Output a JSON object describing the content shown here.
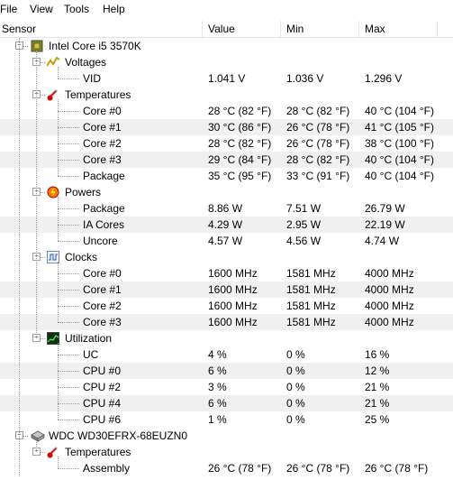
{
  "menu": [
    "File",
    "View",
    "Tools",
    "Help"
  ],
  "columns": {
    "sensor": "Sensor",
    "value": "Value",
    "min": "Min",
    "max": "Max"
  },
  "rows": [
    {
      "type": "device",
      "icon": "cpu-icon",
      "label": "Intel Core i5 3570K"
    },
    {
      "type": "group",
      "icon": "voltage-icon",
      "label": "Voltages"
    },
    {
      "type": "sensor",
      "label": "VID",
      "value": "1.041 V",
      "min": "1.036 V",
      "max": "1.296 V"
    },
    {
      "type": "group",
      "icon": "thermometer-icon",
      "label": "Temperatures"
    },
    {
      "type": "sensor",
      "label": "Core #0",
      "value": "28 °C  (82 °F)",
      "min": "28 °C  (82 °F)",
      "max": "40 °C  (104 °F)"
    },
    {
      "type": "sensor",
      "label": "Core #1",
      "value": "30 °C  (86 °F)",
      "min": "26 °C  (78 °F)",
      "max": "41 °C  (105 °F)"
    },
    {
      "type": "sensor",
      "label": "Core #2",
      "value": "28 °C  (82 °F)",
      "min": "26 °C  (78 °F)",
      "max": "38 °C  (100 °F)"
    },
    {
      "type": "sensor",
      "label": "Core #3",
      "value": "29 °C  (84 °F)",
      "min": "28 °C  (82 °F)",
      "max": "40 °C  (104 °F)"
    },
    {
      "type": "sensor",
      "label": "Package",
      "value": "35 °C  (95 °F)",
      "min": "33 °C  (91 °F)",
      "max": "40 °C  (104 °F)"
    },
    {
      "type": "group",
      "icon": "power-icon",
      "label": "Powers"
    },
    {
      "type": "sensor",
      "label": "Package",
      "value": "8.86 W",
      "min": "7.51 W",
      "max": "26.79 W"
    },
    {
      "type": "sensor",
      "label": "IA Cores",
      "value": "4.29 W",
      "min": "2.95 W",
      "max": "22.19 W"
    },
    {
      "type": "sensor",
      "label": "Uncore",
      "value": "4.57 W",
      "min": "4.56 W",
      "max": "4.74 W"
    },
    {
      "type": "group",
      "icon": "clock-icon",
      "label": "Clocks"
    },
    {
      "type": "sensor",
      "label": "Core #0",
      "value": "1600 MHz",
      "min": "1581 MHz",
      "max": "4000 MHz"
    },
    {
      "type": "sensor",
      "label": "Core #1",
      "value": "1600 MHz",
      "min": "1581 MHz",
      "max": "4000 MHz"
    },
    {
      "type": "sensor",
      "label": "Core #2",
      "value": "1600 MHz",
      "min": "1581 MHz",
      "max": "4000 MHz"
    },
    {
      "type": "sensor",
      "label": "Core #3",
      "value": "1600 MHz",
      "min": "1581 MHz",
      "max": "4000 MHz"
    },
    {
      "type": "group",
      "icon": "utilization-icon",
      "label": "Utilization"
    },
    {
      "type": "sensor",
      "label": "UC",
      "value": "4 %",
      "min": "0 %",
      "max": "16 %"
    },
    {
      "type": "sensor",
      "label": "CPU #0",
      "value": "6 %",
      "min": "0 %",
      "max": "12 %"
    },
    {
      "type": "sensor",
      "label": "CPU #2",
      "value": "3 %",
      "min": "0 %",
      "max": "21 %"
    },
    {
      "type": "sensor",
      "label": "CPU #4",
      "value": "6 %",
      "min": "0 %",
      "max": "21 %"
    },
    {
      "type": "sensor",
      "label": "CPU #6",
      "value": "1 %",
      "min": "0 %",
      "max": "25 %"
    },
    {
      "type": "device",
      "icon": "hdd-icon",
      "label": "WDC WD30EFRX-68EUZN0"
    },
    {
      "type": "group",
      "icon": "thermometer-icon",
      "label": "Temperatures"
    },
    {
      "type": "sensor",
      "label": "Assembly",
      "value": "26 °C  (78 °F)",
      "min": "26 °C  (78 °F)",
      "max": "26 °C  (78 °F)"
    }
  ]
}
